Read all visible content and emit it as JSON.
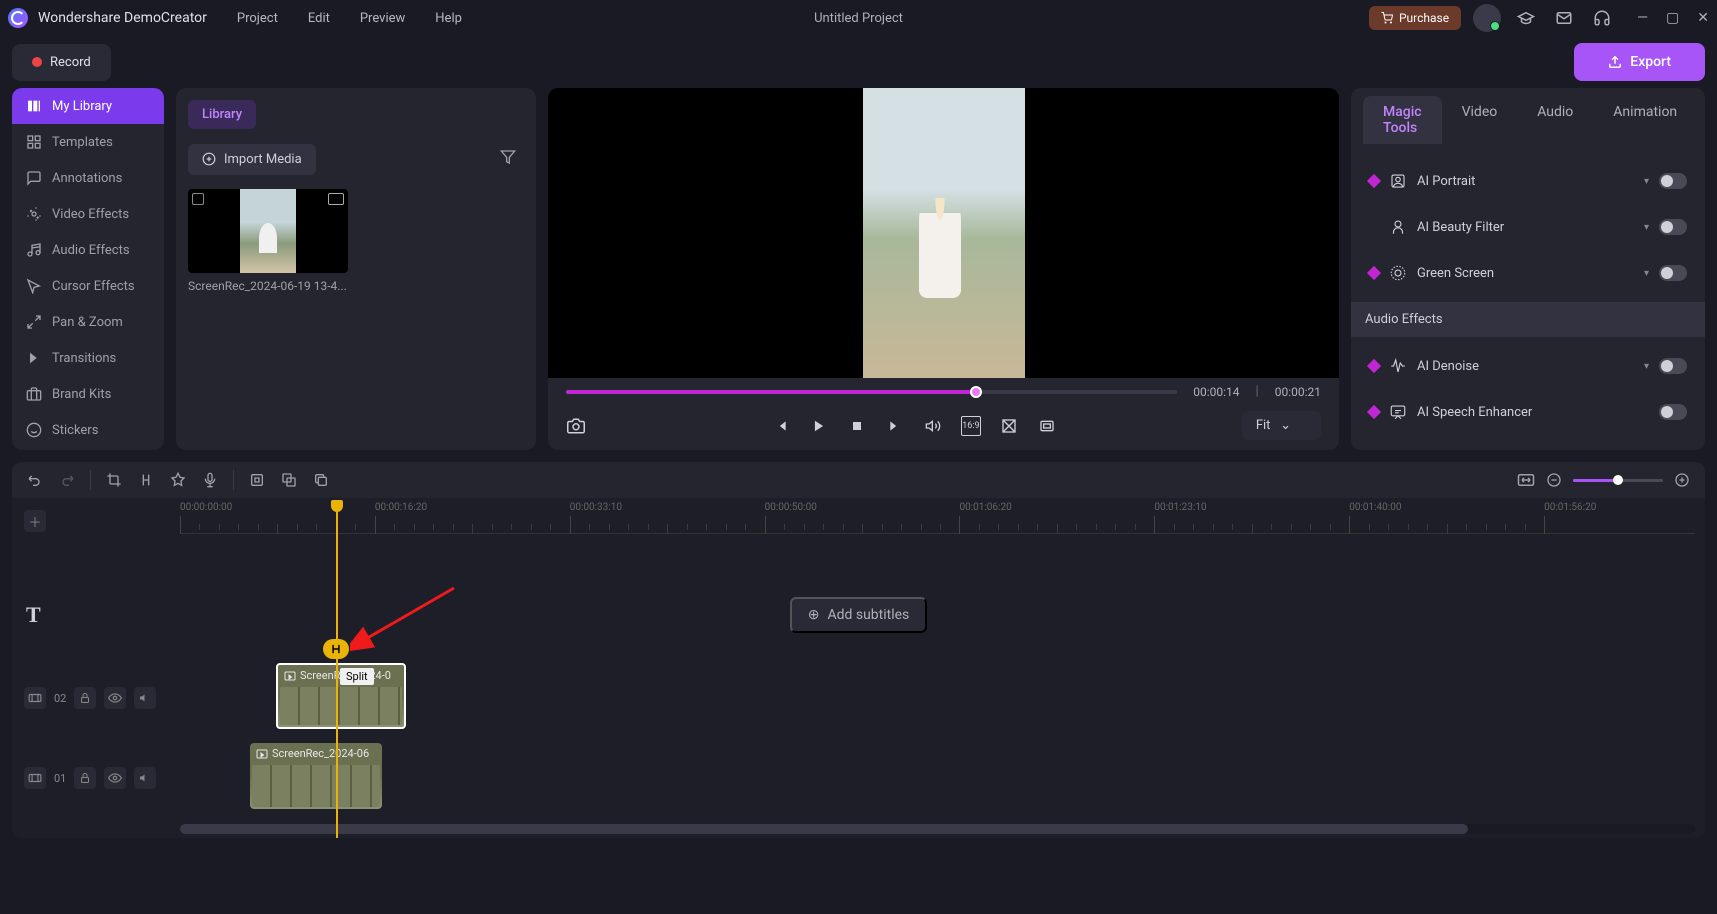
{
  "app_name": "Wondershare DemoCreator",
  "project_title": "Untitled Project",
  "menu": {
    "project": "Project",
    "edit": "Edit",
    "preview": "Preview",
    "help": "Help"
  },
  "purchase_label": "Purchase",
  "record_label": "Record",
  "export_label": "Export",
  "sidebar": {
    "items": [
      {
        "label": "My Library"
      },
      {
        "label": "Templates"
      },
      {
        "label": "Annotations"
      },
      {
        "label": "Video Effects"
      },
      {
        "label": "Audio Effects"
      },
      {
        "label": "Cursor Effects"
      },
      {
        "label": "Pan & Zoom"
      },
      {
        "label": "Transitions"
      },
      {
        "label": "Brand Kits"
      },
      {
        "label": "Stickers"
      }
    ]
  },
  "library": {
    "tab": "Library",
    "import_label": "Import Media",
    "media_name": "ScreenRec_2024-06-19 13-4..."
  },
  "preview": {
    "time_current": "00:00:14",
    "time_total": "00:00:21",
    "fit_label": "Fit"
  },
  "props": {
    "tabs": {
      "magic": "Magic Tools",
      "video": "Video",
      "audio": "Audio",
      "animation": "Animation"
    },
    "ai_portrait": "AI Portrait",
    "ai_beauty": "AI Beauty Filter",
    "green_screen": "Green Screen",
    "audio_effects": "Audio Effects",
    "ai_denoise": "AI Denoise",
    "ai_speech": "AI Speech Enhancer"
  },
  "timeline": {
    "ruler": [
      "00:00:00:00",
      "00:00:16:20",
      "00:00:33:10",
      "00:00:50:00",
      "00:01:06:20",
      "00:01:23:10",
      "00:01:40:00",
      "00:01:56:20"
    ],
    "add_subtitles": "Add subtitles",
    "track02": "02",
    "track01": "01",
    "clip2_label": "ScreenRec_2024-0",
    "clip1_label": "ScreenRec_2024-06",
    "split_tooltip": "Split"
  }
}
